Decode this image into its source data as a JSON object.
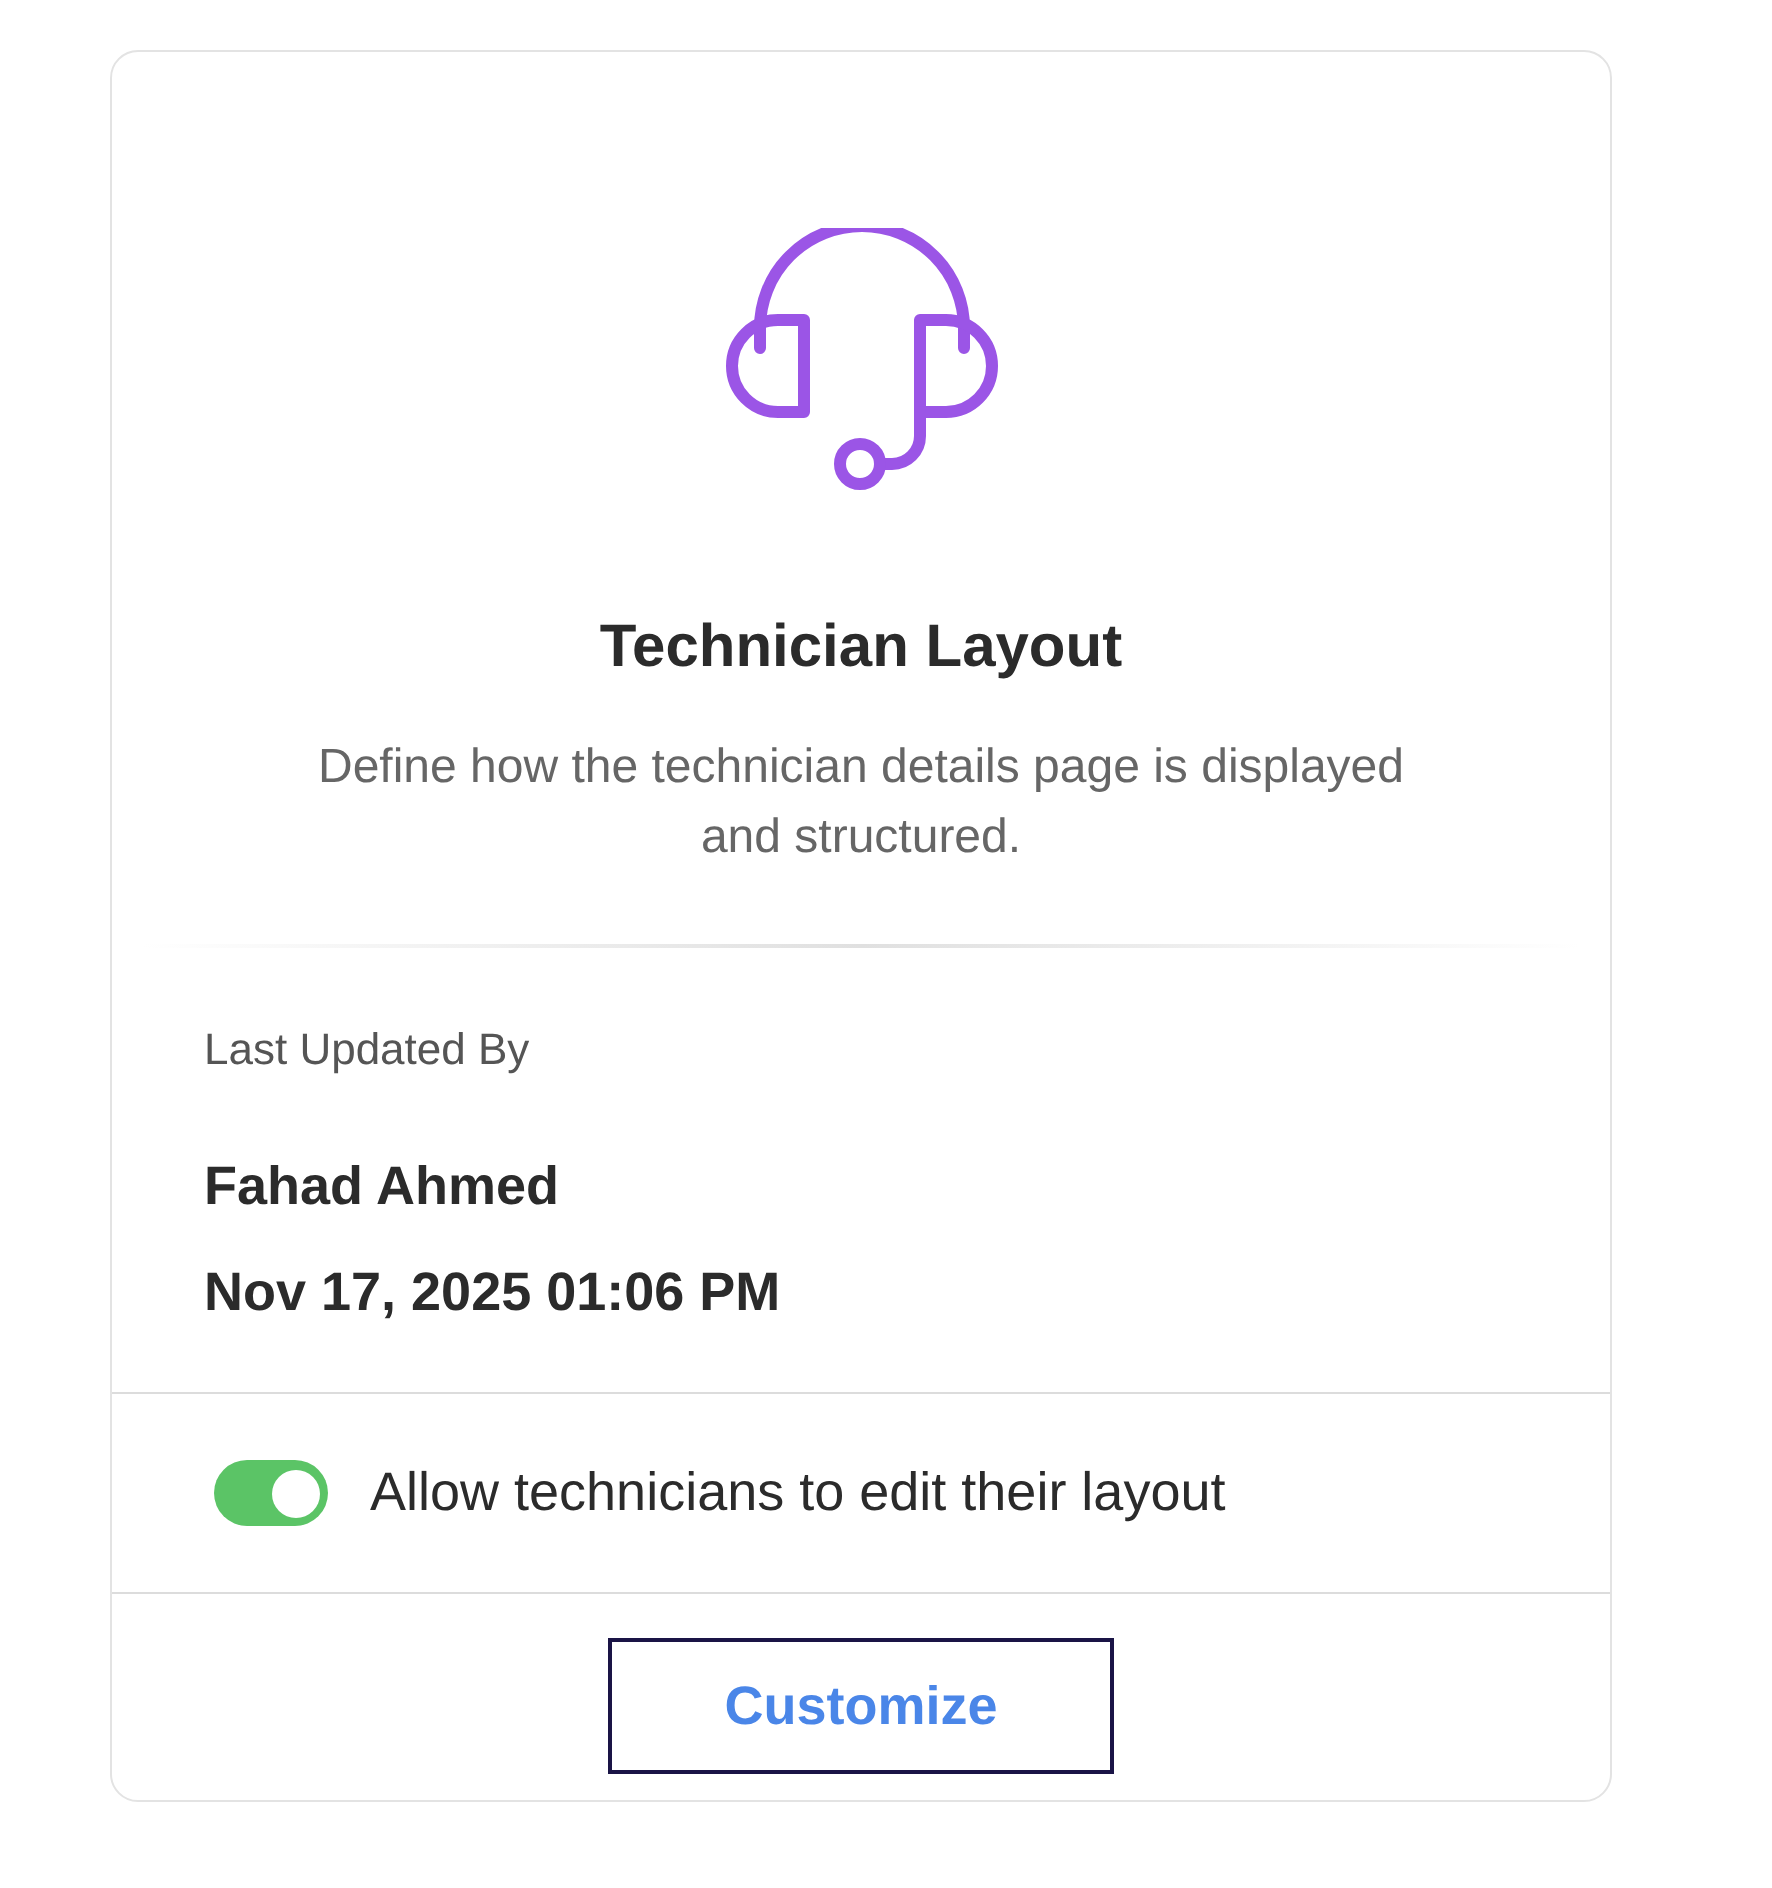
{
  "card": {
    "title": "Technician Layout",
    "description": "Define how the technician details page is displayed and structured.",
    "last_updated_label": "Last Updated By",
    "updated_by": "Fahad Ahmed",
    "updated_at": "Nov 17, 2025 01:06 PM",
    "toggle": {
      "label": "Allow technicians to edit their layout",
      "on": true
    },
    "button": "Customize"
  }
}
